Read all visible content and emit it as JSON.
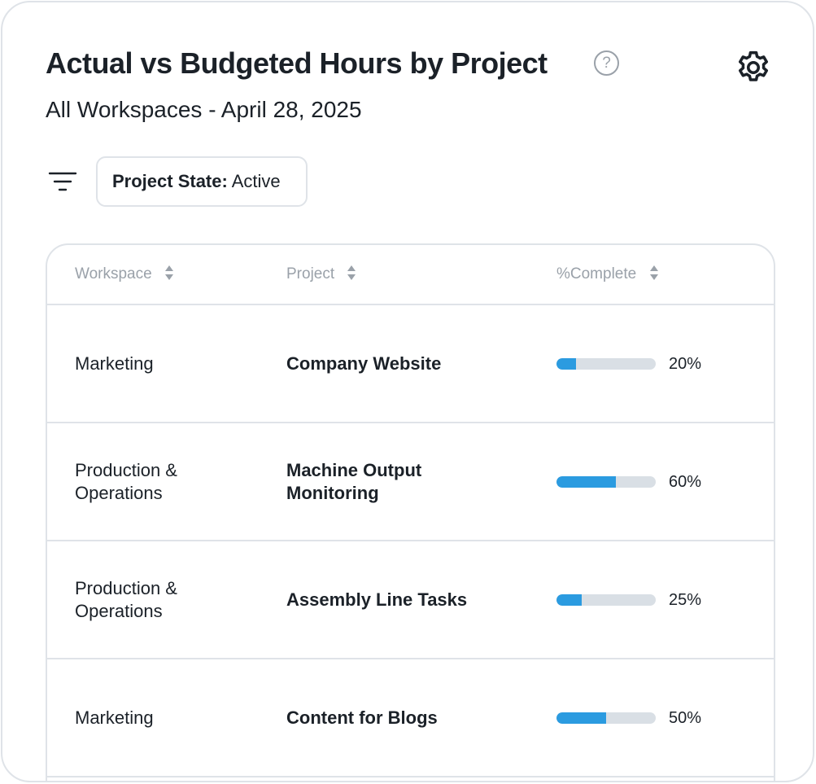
{
  "header": {
    "title": "Actual vs Budgeted Hours by Project",
    "help_glyph": "?",
    "subtitle": "All Workspaces - April 28, 2025",
    "icons": {
      "help": "question-circle-icon",
      "settings": "gear-icon",
      "filter": "filter-lines-icon"
    }
  },
  "filter": {
    "key": "Project State:",
    "value": "Active"
  },
  "table": {
    "columns": [
      "Workspace",
      "Project",
      "%Complete"
    ],
    "rows": [
      {
        "workspace": "Marketing",
        "project": "Company Website",
        "percent": 20,
        "percent_label": "20%"
      },
      {
        "workspace": "Production & Operations",
        "project": "Machine Output Monitoring",
        "percent": 60,
        "percent_label": "60%"
      },
      {
        "workspace": "Production & Operations",
        "project": "Assembly Line Tasks",
        "percent": 25,
        "percent_label": "25%"
      },
      {
        "workspace": "Marketing",
        "project": "Content for Blogs",
        "percent": 50,
        "percent_label": "50%"
      }
    ]
  },
  "colors": {
    "accent": "#2b9be0",
    "track": "#d9dfe5",
    "border": "#dfe3e8",
    "muted": "#9aa1a9",
    "text": "#1b2128"
  }
}
